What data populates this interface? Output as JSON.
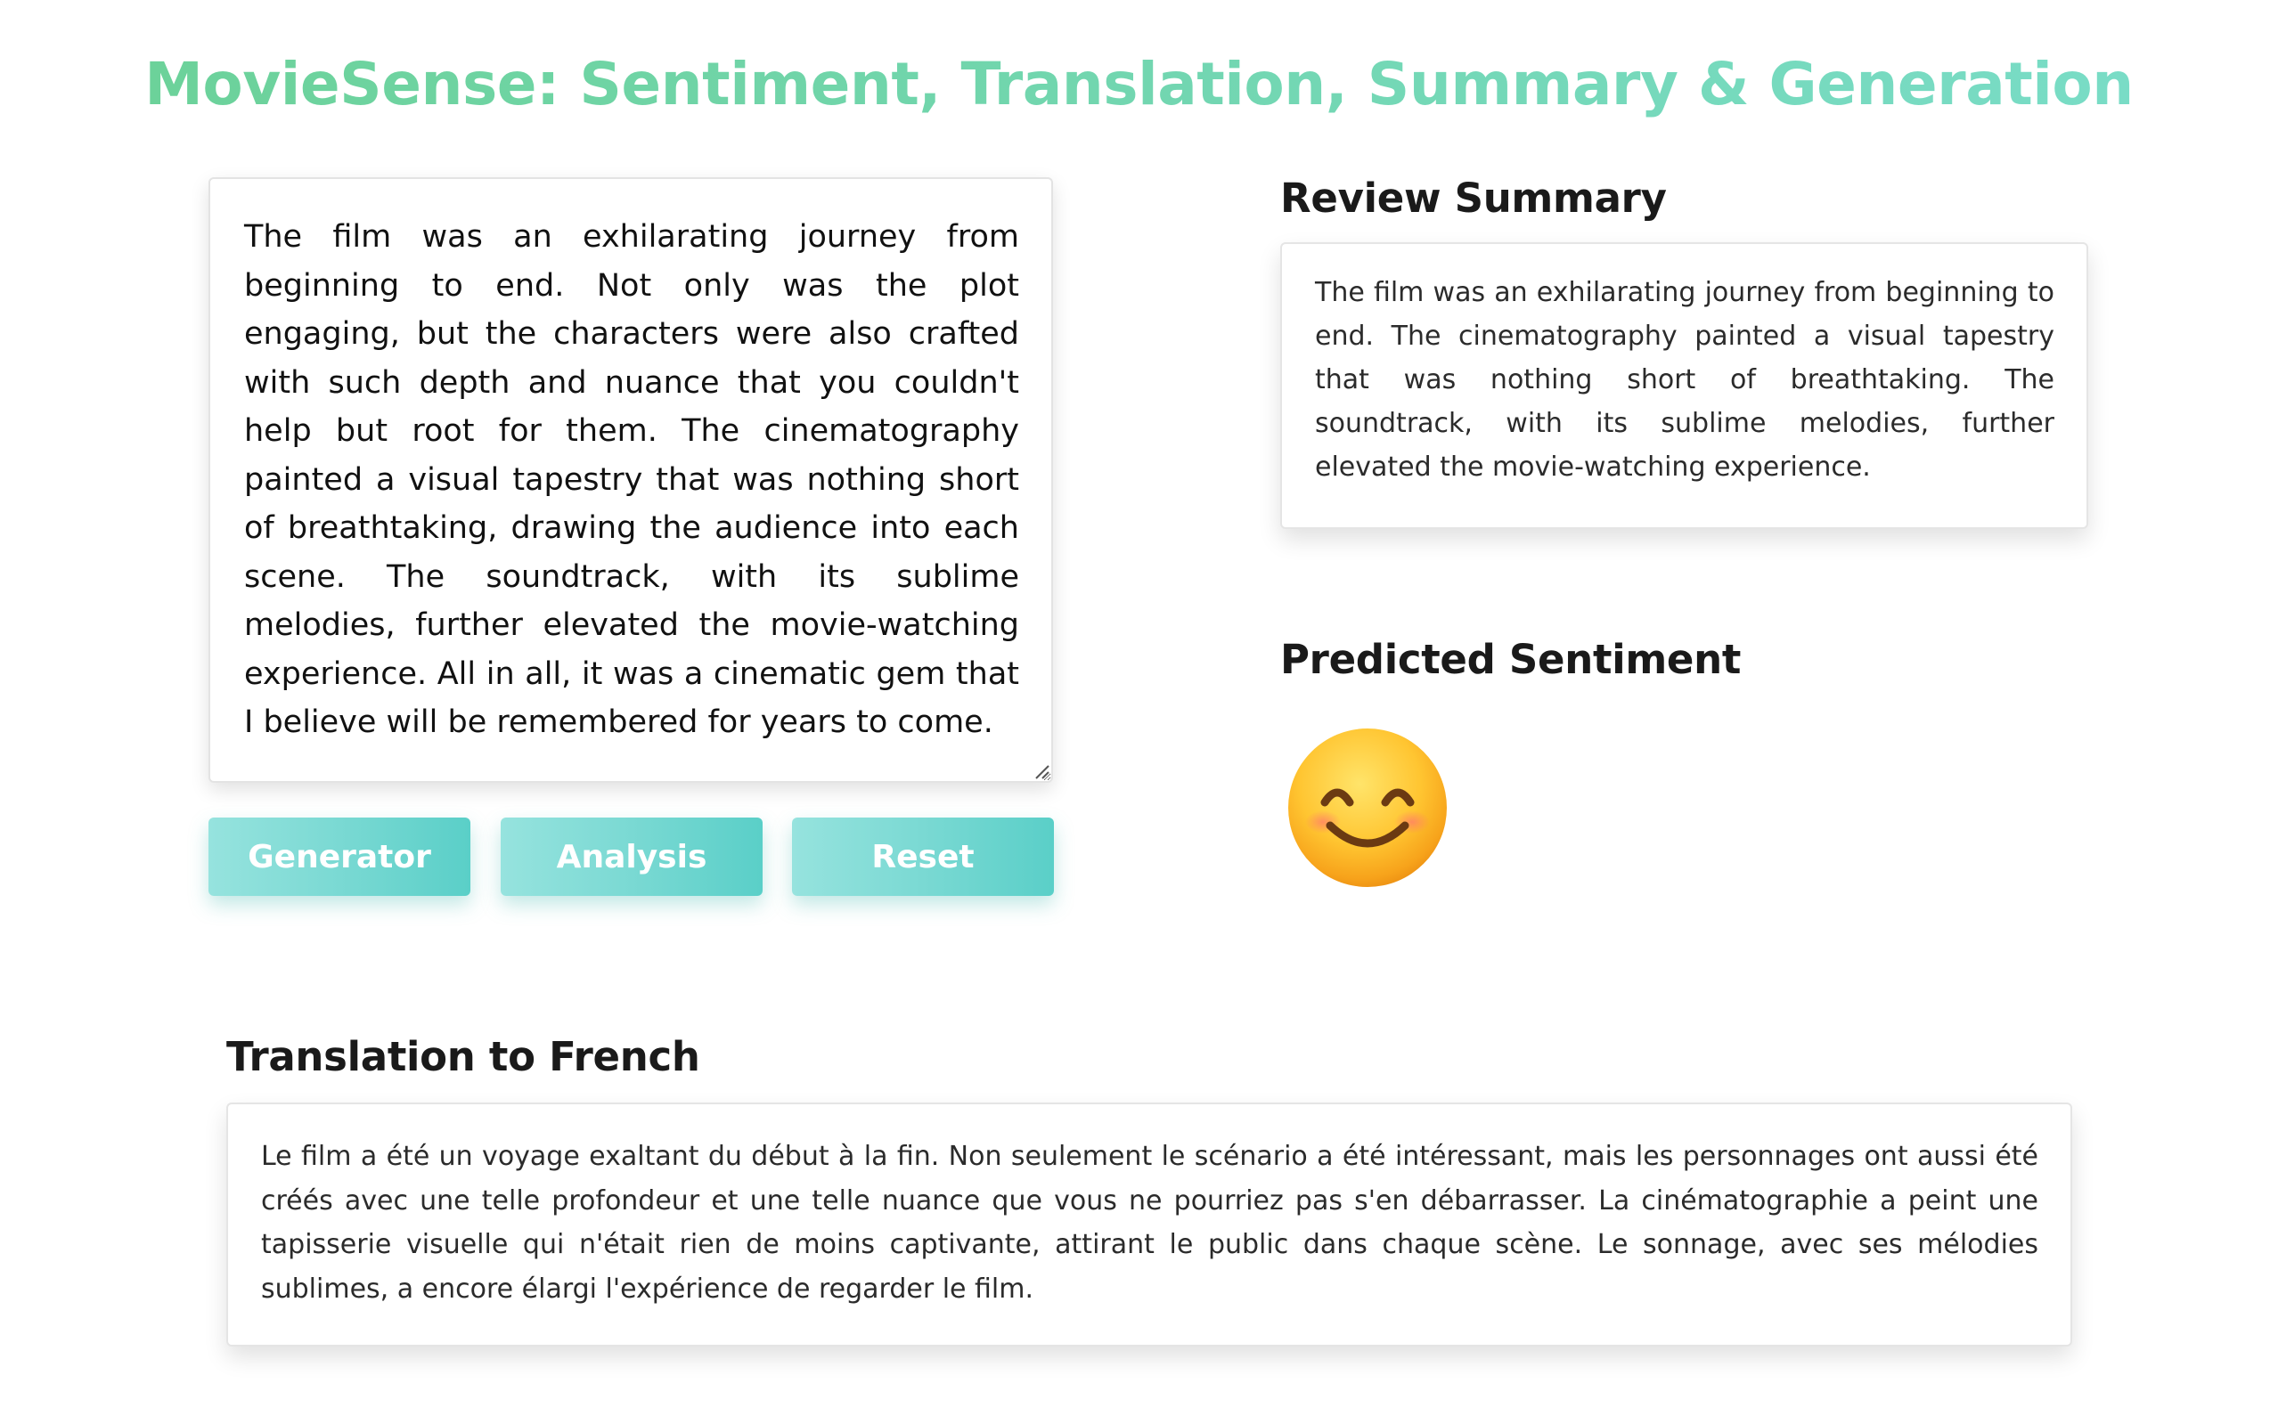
{
  "page": {
    "title": "MovieSense: Sentiment, Translation, Summary & Generation"
  },
  "review_input": {
    "value": "The film was an exhilarating journey from beginning to end. Not only was the plot engaging, but the characters were also crafted with such depth and nuance that you couldn't help but root for them. The cinematography painted a visual tapestry that was nothing short of breathtaking, drawing the audience into each scene. The soundtrack, with its sublime melodies, further elevated the movie-watching experience. All in all, it was a cinematic gem that I believe will be remembered for years to come."
  },
  "buttons": {
    "generator_label": "Generator",
    "analysis_label": "Analysis",
    "reset_label": "Reset"
  },
  "summary": {
    "heading": "Review Summary",
    "text": "The film was an exhilarating journey from beginning to end. The cinematography painted a visual tapestry that was nothing short of breathtaking. The soundtrack, with its sublime melodies, further elevated the movie-watching experience."
  },
  "sentiment": {
    "heading": "Predicted Sentiment",
    "icon": "smiling-face-with-smiling-eyes-icon"
  },
  "translation": {
    "heading": "Translation to French",
    "text": "Le film a été un voyage exaltant du début à la fin. Non seulement le scénario a été intéressant, mais les personnages ont aussi été créés avec une telle profondeur et une telle nuance que vous ne pourriez pas s'en débarrasser. La cinématographie a peint une tapisserie visuelle qui n'était rien de moins captivante, attirant le public dans chaque scène. Le sonnage, avec ses mélodies sublimes, a encore élargi l'expérience de regarder le film."
  },
  "colors": {
    "title_gradient_start": "#6cd29a",
    "title_gradient_end": "#79dcc6",
    "button_gradient_start": "#96e3de",
    "button_gradient_end": "#5acfc8",
    "heading_text": "#1a1a1a"
  }
}
